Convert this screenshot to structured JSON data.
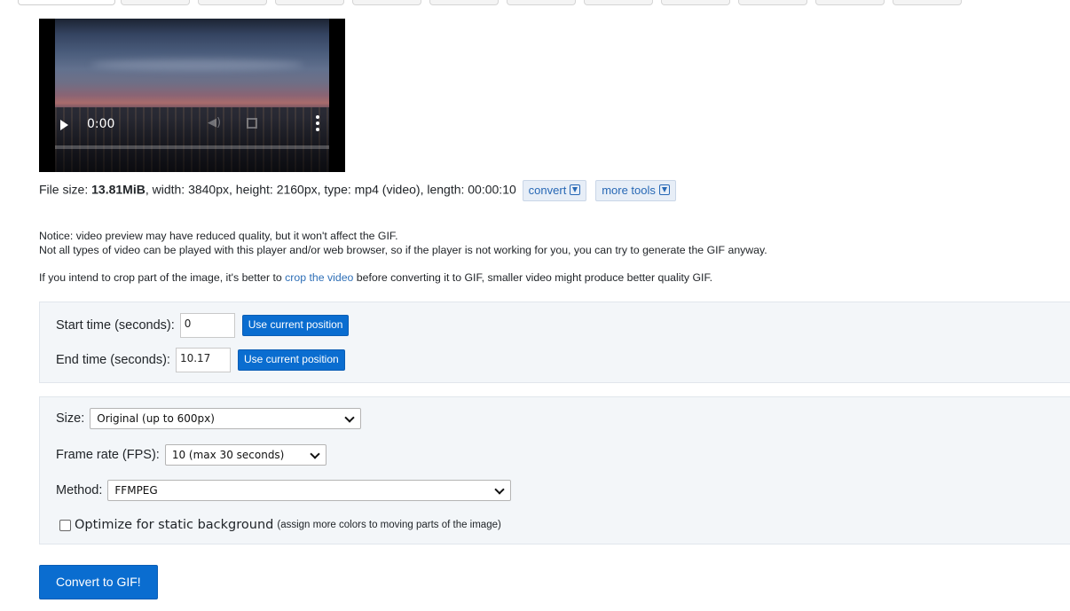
{
  "video": {
    "time": "0:00"
  },
  "file_info": {
    "size_label": "File size: ",
    "size_value": "13.81MiB",
    "details": ", width: 3840px, height: 2160px, type: mp4 (video), length: 00:00:10",
    "convert_button": "convert",
    "more_tools_button": "more tools"
  },
  "notice": {
    "line1": "Notice: video preview may have reduced quality, but it won't affect the GIF.",
    "line2": "Not all types of video can be played with this player and/or web browser, so if the player is not working for you, you can try to generate the GIF anyway.",
    "crop_prefix": "If you intend to crop part of the image, it's better to ",
    "crop_link": "crop the video",
    "crop_suffix": " before converting it to GIF, smaller video might produce better quality GIF."
  },
  "timing": {
    "start_label": "Start time (seconds):",
    "start_value": "0",
    "end_label": "End time (seconds):",
    "end_value": "10.17",
    "use_current_label": "Use current position"
  },
  "options": {
    "size_label": "Size:",
    "size_value": "Original (up to 600px)",
    "fps_label": "Frame rate (FPS):",
    "fps_value": "10 (max 30 seconds)",
    "method_label": "Method:",
    "method_value": "FFMPEG",
    "optimize_label": "Optimize for static background",
    "optimize_hint": "(assign more colors to moving parts of the image)",
    "optimize_checked": false
  },
  "actions": {
    "convert_to_gif": "Convert to GIF!"
  }
}
